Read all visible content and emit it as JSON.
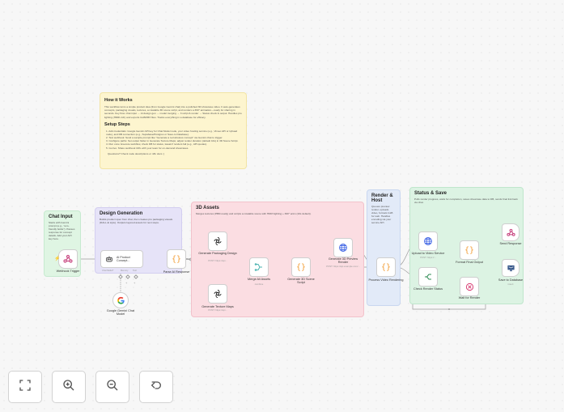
{
  "how": {
    "title": "How it Works",
    "intro": "This workflow turns a simple product idea (from Google Gemini chat) into a polished 3D showcase video. It auto-generates concepts, packaging visuals, textures, a rotatable 3D scene script, and renders a 360° animation—ready for sharing in seconds. Key flow: chat input → AI design gen → model merging → 3 script & render → Status check & output. Handles pro lighting (HDRI-rich) and exports GLB/FBX files. Tracks everything in a database for efficacy.",
    "setup_title": "Setup Steps",
    "steps": [
      "1. Add credentials: Google Gemini API key for Chat Model node, your video hosting service (e.g., Vimeo API or Upload node), and DB connection (e.g., Supabase/Postgres or Save-to Database).",
      "2. Test webhook: Send a sample prompt like \"Generate a red wireless concept\" via Gemini chat to trigger.",
      "3. Configure paths: Set output folder in Generate Texture Maps; adjust render duration (default 10s) in 3D Scene Script.",
      "4. Run once: Execute workflow, check DB for status, tweak if renders fail (e.g., API quotas).",
      "5. Go live: Share webhook URL with your team for on-demand showcases."
    ],
    "footer": "Questions? Check node descriptions or n8n docs :)"
  },
  "groups": {
    "chat": {
      "title": "Chat Input",
      "body": "Starts with Gemini prompt (e.g., \"eco-friendly bottle\"). Passes response for concept details. Add your API key here."
    },
    "design": {
      "title": "Design Generation",
      "body": "Builds product spec from chat, then creates pro packaging visuals (DALL-E style). Outputs layered assets for next steps."
    },
    "three_d": {
      "title": "3D Assets",
      "body": "Merges textures (PBR-ready) and scripts a rotatable scene with HDRI lighting + 360° anim (10s default)."
    },
    "render": {
      "title": "Render & Host",
      "body": "Queues preview render, uploads video, formats GLB for web. Handles encoding via your service API."
    },
    "status": {
      "title": "Status & Save",
      "body": "Polls render progress, waits for completion, saves showcase data to DB, sends final link back via chat."
    }
  },
  "nodes": {
    "webhook": {
      "label": "Webhook Trigger"
    },
    "ai_product": {
      "label": "AI Product Concept...",
      "ports": [
        "Chat Model*",
        "Memory",
        "Tool"
      ]
    },
    "gemini": {
      "label": "Google Gemini Chat Model"
    },
    "parse": {
      "label": "Parse AI Response"
    },
    "packaging": {
      "label": "Generate Packaging Design",
      "sub": "POST: https://api..."
    },
    "texture": {
      "label": "Generate Texture Maps",
      "sub": "POST: https://api..."
    },
    "merge": {
      "label": "Merge All Assets",
      "sub": "combine"
    },
    "scene": {
      "label": "Generate 3D Scene Script"
    },
    "preview": {
      "label": "Generate 3D Preview Render",
      "sub": "POST: https://api.example.com/..."
    },
    "process": {
      "label": "Process Video Rendering"
    },
    "upload": {
      "label": "Upload to Video Service",
      "sub": "POST: https://..."
    },
    "check": {
      "label": "Check Render Status"
    },
    "format": {
      "label": "Format Final Output"
    },
    "wait": {
      "label": "Wait for Render"
    },
    "send": {
      "label": "Send Response"
    },
    "save": {
      "label": "Save to Database",
      "sub": "insert"
    }
  },
  "icons": {
    "webhook": "webhook-icon",
    "ai_product": "robot-icon",
    "gemini": "google-icon",
    "code": "braces-icon",
    "openai": "openai-icon",
    "merge": "merge-icon",
    "globe": "globe-icon",
    "wait": "stop-icon",
    "database": "database-icon"
  },
  "colors": {
    "code": "#f29e38",
    "openai": "#222222",
    "merge": "#4bb3b0",
    "globe": "#4c6fe6",
    "wait": "#d6336c",
    "database": "#3a5a8c",
    "webhook": "#c94a83",
    "check": "#2f8c55"
  },
  "toolbar": [
    "fit-view-button",
    "zoom-in-button",
    "zoom-out-button",
    "undo-button"
  ]
}
